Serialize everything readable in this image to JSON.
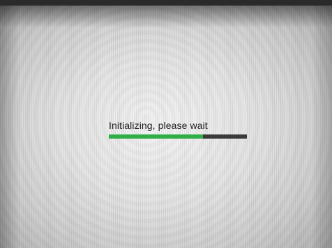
{
  "loader": {
    "status_text": "Initializing, please wait",
    "progress_fraction": 0.68,
    "detail_text": "",
    "colors": {
      "fill": "#2fae45",
      "track": "#3a3a3a",
      "text": "#202020"
    }
  }
}
